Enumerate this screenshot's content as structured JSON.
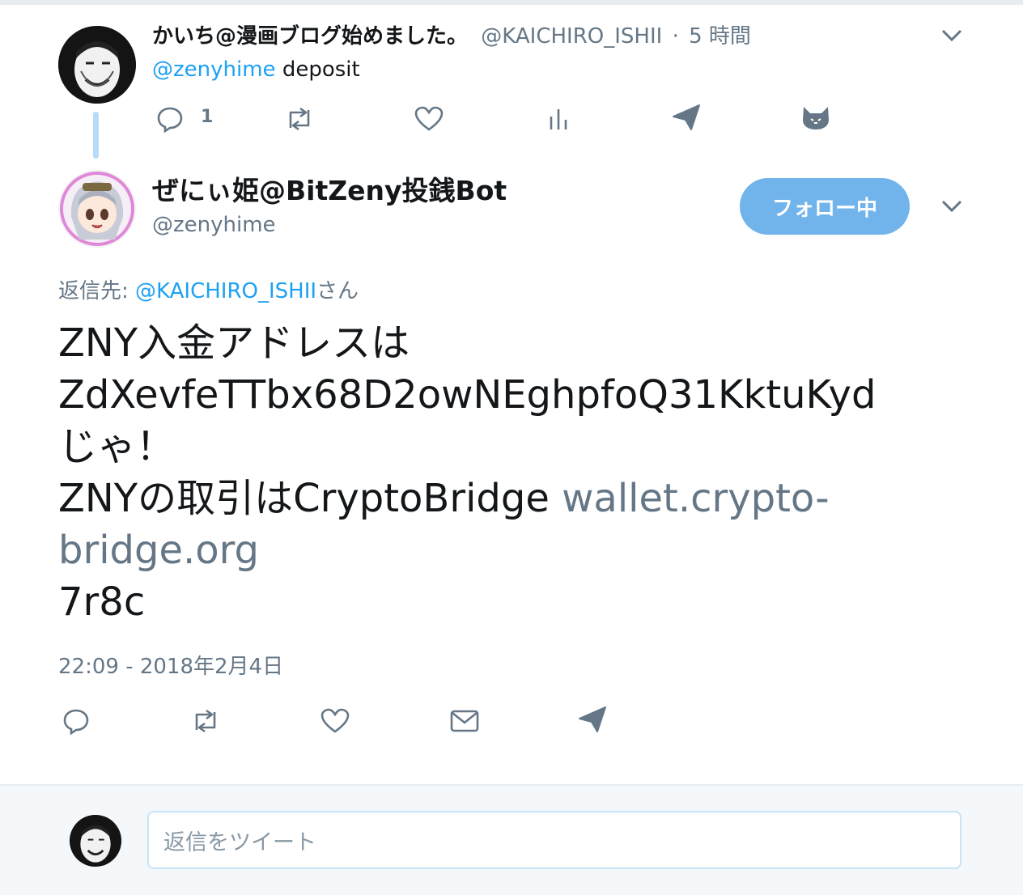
{
  "parent_tweet": {
    "display_name": "かいち@漫画ブログ始めました。",
    "handle": "@KAICHIRO_ISHII",
    "separator": "·",
    "time": "5 時間",
    "mention": "@zenyhime",
    "text": "deposit",
    "reply_count": "1",
    "actions": [
      "reply-icon",
      "retweet-icon",
      "like-icon",
      "analytics-icon",
      "send-dm-icon",
      "cat-icon"
    ]
  },
  "main_tweet": {
    "display_name": "ぜにぃ姫@BitZeny投銭Bot",
    "handle": "@zenyhime",
    "follow_label": "フォロー中",
    "reply_to_prefix": "返信先: ",
    "reply_to_handle": "@KAICHIRO_ISHII",
    "reply_to_suffix": "さん",
    "line1": "ZNY入金アドレスは",
    "line2": "ZdXevfeTTbx68D2owNEghpfoQ31KktuKyd",
    "line3": "じゃ！",
    "line4_text": "ZNYの取引はCryptoBridge ",
    "line4_url": "wallet.crypto-",
    "line5_url": "bridge.org",
    "line6": "7r8c",
    "timestamp": "22:09 - 2018年2月4日",
    "actions": [
      "reply-icon",
      "retweet-icon",
      "like-icon",
      "mail-icon",
      "send-dm-icon"
    ]
  },
  "reply_box": {
    "placeholder": "返信をツイート"
  },
  "colors": {
    "accent": "#1da1f2",
    "follow_button": "#71b4ec",
    "muted": "#657786",
    "thread_line": "#b8dcf7"
  }
}
